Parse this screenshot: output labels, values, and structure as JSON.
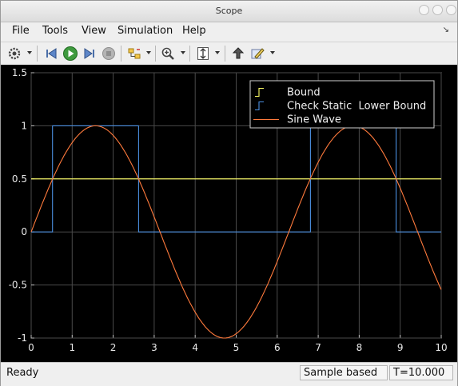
{
  "window": {
    "title": "Scope"
  },
  "menu": {
    "items": [
      {
        "label": "File"
      },
      {
        "label": "Tools"
      },
      {
        "label": "View"
      },
      {
        "label": "Simulation"
      },
      {
        "label": "Help"
      }
    ]
  },
  "toolbar": {
    "icons": [
      "settings-gear-icon",
      "step-back-icon",
      "run-icon",
      "step-forward-icon",
      "stop-icon",
      "signal-select-icon",
      "zoom-in-icon",
      "autoscale-icon",
      "highlight-block-icon",
      "edit-style-icon"
    ]
  },
  "status": {
    "state": "Ready",
    "mode": "Sample based",
    "time": "T=10.000"
  },
  "chart_data": {
    "type": "line",
    "title": "",
    "xlabel": "",
    "ylabel": "",
    "xlim": [
      0,
      10
    ],
    "ylim": [
      -1,
      1.5
    ],
    "xticks": [
      "0",
      "1",
      "2",
      "3",
      "4",
      "5",
      "6",
      "7",
      "8",
      "9",
      "10"
    ],
    "yticks": [
      "-1",
      "-0.5",
      "0",
      "0.5",
      "1",
      "1.5"
    ],
    "grid": true,
    "legend": "top-right",
    "series": [
      {
        "name": "Bound",
        "color": "#ffff66",
        "step": true,
        "x": [
          0,
          10
        ],
        "y": [
          0.5,
          0.5
        ]
      },
      {
        "name": "Check Static  Lower Bound",
        "color": "#4b8fe0",
        "step": true,
        "x": [
          0,
          0.52,
          0.52,
          2.62,
          2.62,
          6.81,
          6.81,
          8.9,
          8.9,
          10
        ],
        "y": [
          0,
          0,
          1,
          1,
          0,
          0,
          1,
          1,
          0,
          0
        ]
      },
      {
        "name": "Sine Wave",
        "color": "#ff7a3c",
        "step": false,
        "x": [
          0,
          0.5,
          1,
          1.5,
          1.571,
          2,
          2.5,
          3,
          3.5,
          4,
          4.5,
          4.712,
          5,
          5.5,
          6,
          6.5,
          7,
          7.5,
          7.854,
          8,
          8.5,
          9,
          9.5,
          10
        ],
        "y": [
          0,
          0.479,
          0.841,
          0.997,
          1,
          0.909,
          0.598,
          0.141,
          -0.351,
          -0.757,
          -0.978,
          -1,
          -0.959,
          -0.706,
          -0.279,
          0.215,
          0.657,
          0.938,
          1,
          0.989,
          0.798,
          0.412,
          -0.075,
          -0.544
        ]
      }
    ]
  }
}
